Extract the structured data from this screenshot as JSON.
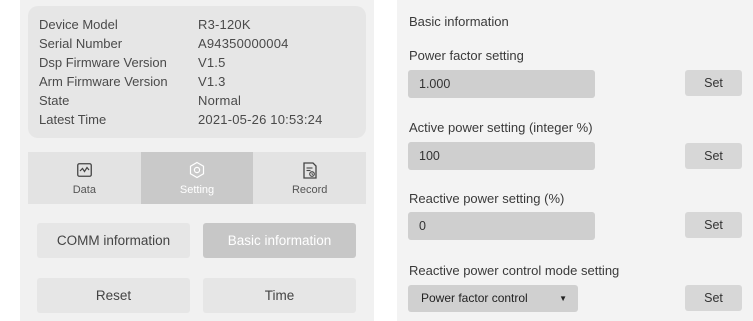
{
  "device_info": [
    {
      "label": "Device Model",
      "value": "R3-120K"
    },
    {
      "label": "Serial Number",
      "value": "A94350000004"
    },
    {
      "label": "Dsp Firmware Version",
      "value": "V1.5"
    },
    {
      "label": "Arm Firmware Version",
      "value": "V1.3"
    },
    {
      "label": "State",
      "value": "Normal"
    },
    {
      "label": "Latest Time",
      "value": "2021-05-26 10:53:24"
    }
  ],
  "tabs": [
    {
      "label": "Data",
      "icon": "chart-icon"
    },
    {
      "label": "Setting",
      "icon": "gear-icon",
      "active": true
    },
    {
      "label": "Record",
      "icon": "record-icon"
    }
  ],
  "buttons": {
    "comm": "COMM information",
    "basic": "Basic information",
    "reset": "Reset",
    "time": "Time"
  },
  "basic_info": {
    "title": "Basic information",
    "power_factor": {
      "label": "Power factor setting",
      "value": "1.000",
      "set": "Set"
    },
    "active_power": {
      "label": "Active power setting (integer %)",
      "value": "100",
      "set": "Set"
    },
    "reactive_power": {
      "label": "Reactive power setting (%)",
      "value": "0",
      "set": "Set"
    },
    "control_mode": {
      "label": "Reactive power control mode setting",
      "value": "Power factor control",
      "set": "Set"
    }
  },
  "colors": {
    "active_tab": "#c9c9c9",
    "input_bg": "#cfcfcf",
    "panel_bg": "#f1f1f1"
  }
}
